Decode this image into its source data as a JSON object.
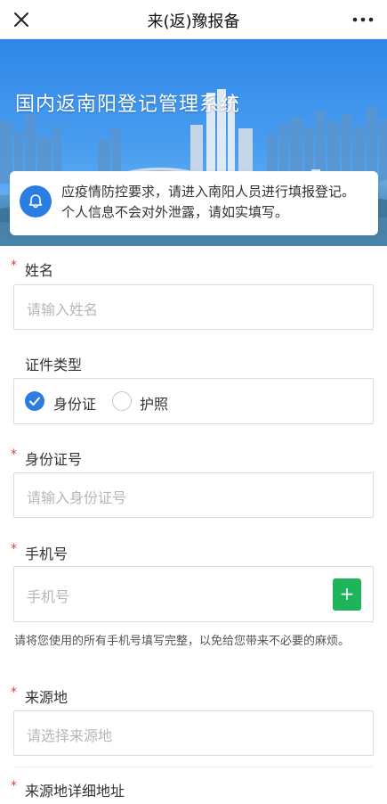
{
  "nav": {
    "title": "来(返)豫报备",
    "close_icon": "close-icon",
    "more_icon": "more-icon"
  },
  "banner": {
    "title": "国内返南阳登记管理系统"
  },
  "notice": {
    "icon": "bell-icon",
    "text": "应疫情防控要求，请进入南阳人员进行填报登记。个人信息不会对外泄露，请如实填写。"
  },
  "form": {
    "required_mark": "*",
    "name": {
      "label": "姓名",
      "placeholder": "请输入姓名"
    },
    "id_type": {
      "label": "证件类型",
      "options": [
        {
          "label": "身份证",
          "selected": true
        },
        {
          "label": "护照",
          "selected": false
        }
      ]
    },
    "id_number": {
      "label": "身份证号",
      "placeholder": "请输入身份证号"
    },
    "phone": {
      "label": "手机号",
      "placeholder": "手机号",
      "add_label": "+",
      "hint": "请将您使用的所有手机号填写完整，以免给您带来不必要的麻烦。"
    },
    "origin": {
      "label": "来源地",
      "placeholder": "请选择来源地"
    },
    "origin_detail": {
      "label": "来源地详细地址"
    }
  },
  "colors": {
    "accent": "#2b7de1",
    "required": "#e23b3b",
    "add_button": "#1db45a"
  }
}
